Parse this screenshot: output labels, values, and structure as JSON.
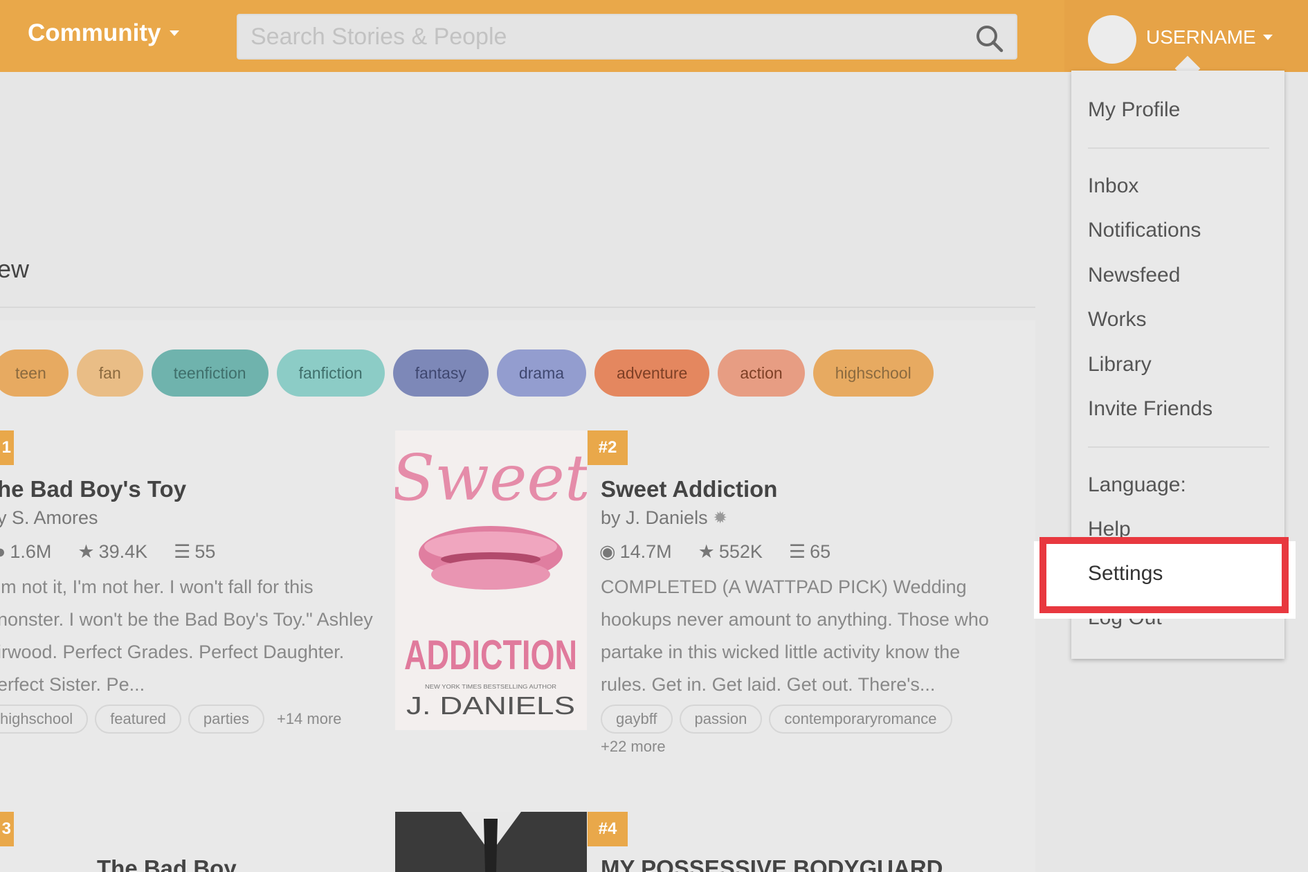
{
  "header": {
    "community_label": "Community",
    "search_placeholder": "Search Stories & People",
    "username": "USERNAME"
  },
  "section_word": "ew",
  "tags": [
    {
      "label": "teen",
      "bg": "#e7aa61",
      "fg": "#8b6a3f"
    },
    {
      "label": "fan",
      "bg": "#e9bd86",
      "fg": "#8b6a3f"
    },
    {
      "label": "teenfiction",
      "bg": "#6fb3ad",
      "fg": "#3f6f6b"
    },
    {
      "label": "fanfiction",
      "bg": "#8cccc6",
      "fg": "#3f6f6b"
    },
    {
      "label": "fantasy",
      "bg": "#7d88b8",
      "fg": "#3f4770"
    },
    {
      "label": "drama",
      "bg": "#939dcf",
      "fg": "#3f4770"
    },
    {
      "label": "adventure",
      "bg": "#e4875f",
      "fg": "#7d3f25"
    },
    {
      "label": "action",
      "bg": "#e79d83",
      "fg": "#7d3f25"
    },
    {
      "label": "highschool",
      "bg": "#e7aa61",
      "fg": "#8b6a3f"
    }
  ],
  "stories": [
    {
      "rank": "1",
      "title": "he Bad Boy's Toy",
      "author": "y S. Amores",
      "reads": "1.6M",
      "votes": "39.4K",
      "parts": "55",
      "desc": [
        "'m not it, I'm not her. I won't fall for this",
        "nonster. I won't be the Bad Boy's Toy.\" Ashley",
        "irwood. Perfect Grades. Perfect Daughter.",
        "erfect Sister. Pe..."
      ],
      "tags": [
        "highschool",
        "featured",
        "parties"
      ],
      "more": "+14 more"
    },
    {
      "rank": "#2",
      "title": "Sweet Addiction",
      "author": "by J. Daniels",
      "reads": "14.7M",
      "votes": "552K",
      "parts": "65",
      "desc": [
        "COMPLETED (A WATTPAD PICK) Wedding",
        "hookups never amount to anything. Those who",
        "partake in this wicked little activity know the",
        "rules. Get in. Get laid. Get out. There's..."
      ],
      "tags": [
        "gaybff",
        "passion",
        "contemporaryromance"
      ],
      "more": "+22 more"
    },
    {
      "rank": "3",
      "title": "The Bad Boy"
    },
    {
      "rank": "#4",
      "title": "MY POSSESSIVE BODYGUARD"
    }
  ],
  "cover": {
    "script_text": "Sweet",
    "title_text": "ADDICTION",
    "tagline": "NEW YORK TIMES BESTSELLING AUTHOR",
    "author_text": "J. DANIELS"
  },
  "menu": {
    "my_profile": "My Profile",
    "inbox": "Inbox",
    "notifications": "Notifications",
    "newsfeed": "Newsfeed",
    "works": "Works",
    "library": "Library",
    "invite_friends": "Invite Friends",
    "language": "Language:",
    "help": "Help",
    "settings": "Settings",
    "log_out": "Log Out"
  },
  "colors": {
    "brand": "#e9a84a",
    "highlight": "#e8383f"
  }
}
